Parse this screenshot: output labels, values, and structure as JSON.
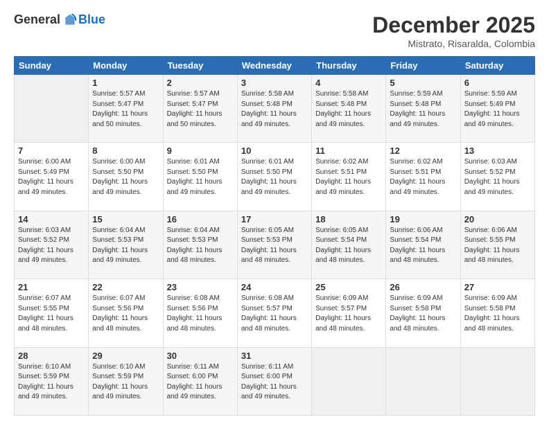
{
  "header": {
    "logo": {
      "general": "General",
      "blue": "Blue"
    },
    "title": "December 2025",
    "location": "Mistrato, Risaralda, Colombia"
  },
  "weekdays": [
    "Sunday",
    "Monday",
    "Tuesday",
    "Wednesday",
    "Thursday",
    "Friday",
    "Saturday"
  ],
  "weeks": [
    [
      {
        "day": "",
        "empty": true
      },
      {
        "day": "1",
        "sunrise": "5:57 AM",
        "sunset": "5:47 PM",
        "daylight": "11 hours and 50 minutes."
      },
      {
        "day": "2",
        "sunrise": "5:57 AM",
        "sunset": "5:47 PM",
        "daylight": "11 hours and 50 minutes."
      },
      {
        "day": "3",
        "sunrise": "5:58 AM",
        "sunset": "5:48 PM",
        "daylight": "11 hours and 49 minutes."
      },
      {
        "day": "4",
        "sunrise": "5:58 AM",
        "sunset": "5:48 PM",
        "daylight": "11 hours and 49 minutes."
      },
      {
        "day": "5",
        "sunrise": "5:59 AM",
        "sunset": "5:48 PM",
        "daylight": "11 hours and 49 minutes."
      },
      {
        "day": "6",
        "sunrise": "5:59 AM",
        "sunset": "5:49 PM",
        "daylight": "11 hours and 49 minutes."
      }
    ],
    [
      {
        "day": "7",
        "sunrise": "6:00 AM",
        "sunset": "5:49 PM",
        "daylight": "11 hours and 49 minutes."
      },
      {
        "day": "8",
        "sunrise": "6:00 AM",
        "sunset": "5:50 PM",
        "daylight": "11 hours and 49 minutes."
      },
      {
        "day": "9",
        "sunrise": "6:01 AM",
        "sunset": "5:50 PM",
        "daylight": "11 hours and 49 minutes."
      },
      {
        "day": "10",
        "sunrise": "6:01 AM",
        "sunset": "5:50 PM",
        "daylight": "11 hours and 49 minutes."
      },
      {
        "day": "11",
        "sunrise": "6:02 AM",
        "sunset": "5:51 PM",
        "daylight": "11 hours and 49 minutes."
      },
      {
        "day": "12",
        "sunrise": "6:02 AM",
        "sunset": "5:51 PM",
        "daylight": "11 hours and 49 minutes."
      },
      {
        "day": "13",
        "sunrise": "6:03 AM",
        "sunset": "5:52 PM",
        "daylight": "11 hours and 49 minutes."
      }
    ],
    [
      {
        "day": "14",
        "sunrise": "6:03 AM",
        "sunset": "5:52 PM",
        "daylight": "11 hours and 49 minutes."
      },
      {
        "day": "15",
        "sunrise": "6:04 AM",
        "sunset": "5:53 PM",
        "daylight": "11 hours and 49 minutes."
      },
      {
        "day": "16",
        "sunrise": "6:04 AM",
        "sunset": "5:53 PM",
        "daylight": "11 hours and 48 minutes."
      },
      {
        "day": "17",
        "sunrise": "6:05 AM",
        "sunset": "5:53 PM",
        "daylight": "11 hours and 48 minutes."
      },
      {
        "day": "18",
        "sunrise": "6:05 AM",
        "sunset": "5:54 PM",
        "daylight": "11 hours and 48 minutes."
      },
      {
        "day": "19",
        "sunrise": "6:06 AM",
        "sunset": "5:54 PM",
        "daylight": "11 hours and 48 minutes."
      },
      {
        "day": "20",
        "sunrise": "6:06 AM",
        "sunset": "5:55 PM",
        "daylight": "11 hours and 48 minutes."
      }
    ],
    [
      {
        "day": "21",
        "sunrise": "6:07 AM",
        "sunset": "5:55 PM",
        "daylight": "11 hours and 48 minutes."
      },
      {
        "day": "22",
        "sunrise": "6:07 AM",
        "sunset": "5:56 PM",
        "daylight": "11 hours and 48 minutes."
      },
      {
        "day": "23",
        "sunrise": "6:08 AM",
        "sunset": "5:56 PM",
        "daylight": "11 hours and 48 minutes."
      },
      {
        "day": "24",
        "sunrise": "6:08 AM",
        "sunset": "5:57 PM",
        "daylight": "11 hours and 48 minutes."
      },
      {
        "day": "25",
        "sunrise": "6:09 AM",
        "sunset": "5:57 PM",
        "daylight": "11 hours and 48 minutes."
      },
      {
        "day": "26",
        "sunrise": "6:09 AM",
        "sunset": "5:58 PM",
        "daylight": "11 hours and 48 minutes."
      },
      {
        "day": "27",
        "sunrise": "6:09 AM",
        "sunset": "5:58 PM",
        "daylight": "11 hours and 48 minutes."
      }
    ],
    [
      {
        "day": "28",
        "sunrise": "6:10 AM",
        "sunset": "5:59 PM",
        "daylight": "11 hours and 49 minutes."
      },
      {
        "day": "29",
        "sunrise": "6:10 AM",
        "sunset": "5:59 PM",
        "daylight": "11 hours and 49 minutes."
      },
      {
        "day": "30",
        "sunrise": "6:11 AM",
        "sunset": "6:00 PM",
        "daylight": "11 hours and 49 minutes."
      },
      {
        "day": "31",
        "sunrise": "6:11 AM",
        "sunset": "6:00 PM",
        "daylight": "11 hours and 49 minutes."
      },
      {
        "day": "",
        "empty": true
      },
      {
        "day": "",
        "empty": true
      },
      {
        "day": "",
        "empty": true
      }
    ]
  ]
}
